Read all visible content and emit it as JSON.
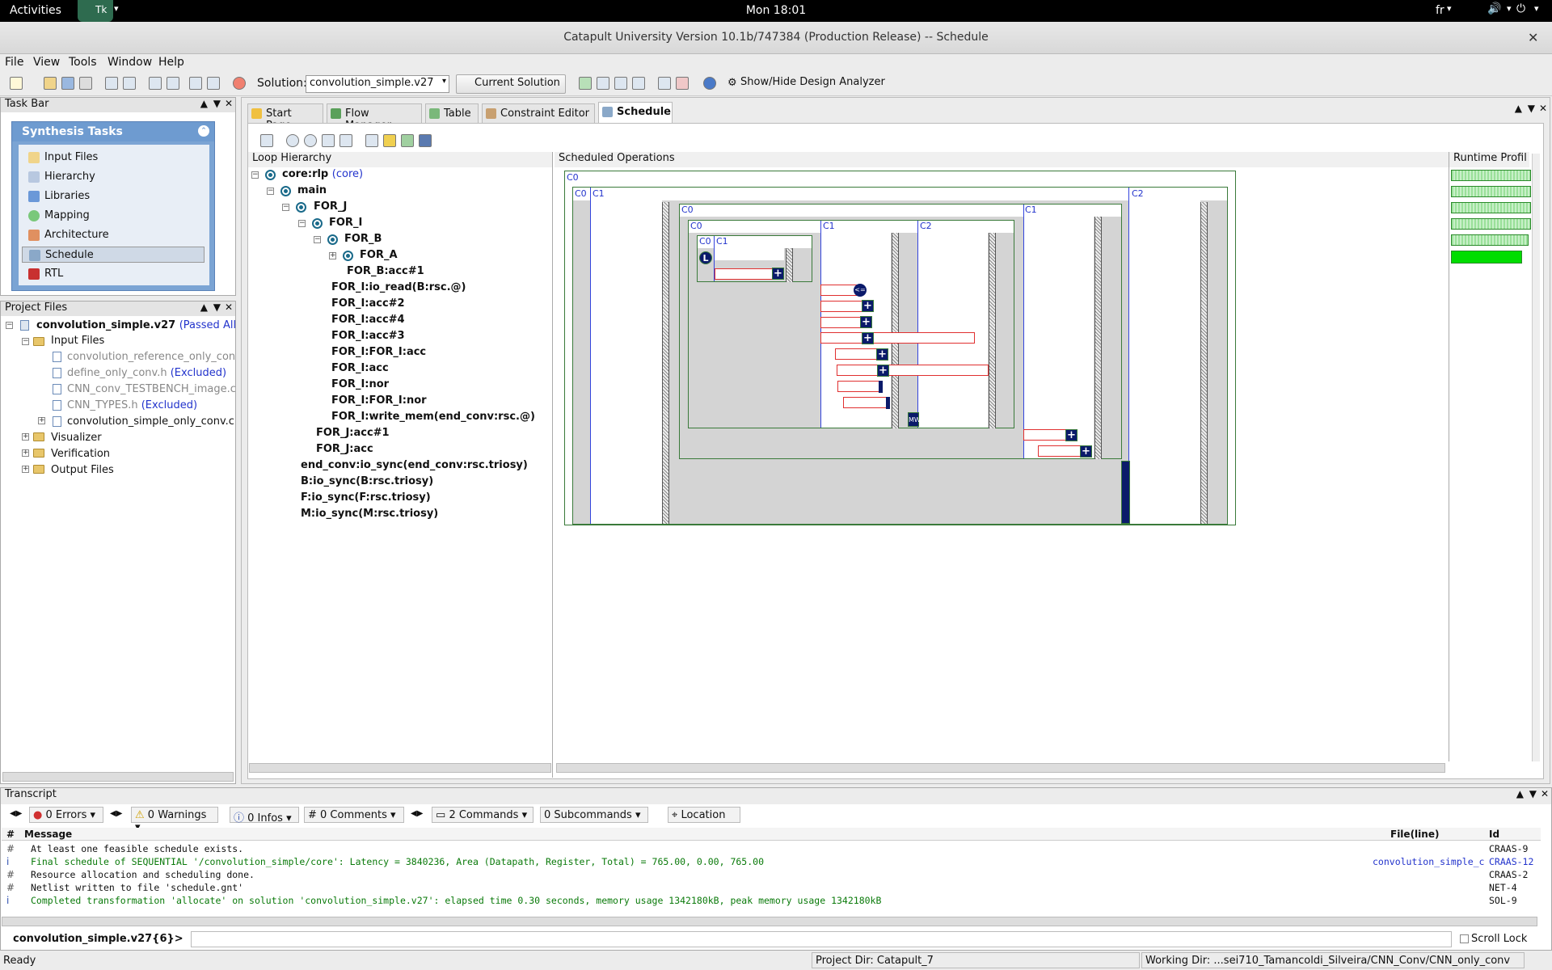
{
  "topbar": {
    "activities": "Activities",
    "clock": "Mon 18:01",
    "lang": "fr"
  },
  "window": {
    "title": "Catapult University Version 10.1b/747384 (Production Release) -- Schedule"
  },
  "menu": {
    "file": "File",
    "view": "View",
    "tools": "Tools",
    "window": "Window",
    "help": "Help"
  },
  "toolbar": {
    "solution_label": "Solution:",
    "solution_value": "convolution_simple.v27",
    "current_solution": "Current Solution",
    "design_analyzer": "Show/Hide Design Analyzer"
  },
  "taskbar": {
    "title": "Task Bar",
    "group": "Synthesis Tasks",
    "items": [
      "Input Files",
      "Hierarchy",
      "Libraries",
      "Mapping",
      "Architecture",
      "Schedule",
      "RTL"
    ],
    "selected": "Schedule"
  },
  "project": {
    "title": "Project Files",
    "root": "convolution_simple.v27",
    "root_status": "(Passed All",
    "input_files": "Input Files",
    "files": [
      {
        "name": "convolution_reference_only_con",
        "status": ""
      },
      {
        "name": "define_only_conv.h",
        "status": "(Excluded)"
      },
      {
        "name": "CNN_conv_TESTBENCH_image.c",
        "status": ""
      },
      {
        "name": "CNN_TYPES.h",
        "status": "(Excluded)"
      },
      {
        "name": "convolution_simple_only_conv.c",
        "status": ""
      }
    ],
    "folders": [
      "Visualizer",
      "Verification",
      "Output Files"
    ]
  },
  "tabs": [
    "Start Page",
    "Flow Manager",
    "Table",
    "Constraint Editor",
    "Schedule"
  ],
  "loop_hierarchy": {
    "title": "Loop Hierarchy",
    "core": "core:rlp",
    "core_tag": "(core)",
    "main": "main",
    "for_j": "FOR_J",
    "for_i": "FOR_I",
    "for_b": "FOR_B",
    "for_a": "FOR_A",
    "ops": [
      "FOR_B:acc#1",
      "FOR_I:io_read(B:rsc.@)",
      "FOR_I:acc#2",
      "FOR_I:acc#4",
      "FOR_I:acc#3",
      "FOR_I:FOR_I:acc",
      "FOR_I:acc",
      "FOR_I:nor",
      "FOR_I:FOR_I:nor",
      "FOR_I:write_mem(end_conv:rsc.@)"
    ],
    "j_ops": [
      "FOR_J:acc#1",
      "FOR_J:acc"
    ],
    "syncs": [
      "end_conv:io_sync(end_conv:rsc.triosy)",
      "B:io_sync(B:rsc.triosy)",
      "F:io_sync(F:rsc.triosy)",
      "M:io_sync(M:rsc.triosy)"
    ]
  },
  "schedule": {
    "title": "Scheduled Operations",
    "runtime": "Runtime Profil"
  },
  "transcript": {
    "title": "Transcript",
    "errors": "0 Errors",
    "warnings": "0 Warnings",
    "infos": "0 Infos",
    "comments": "0 Comments",
    "commands": "2 Commands",
    "subcommands": "0 Subcommands",
    "location": "Location",
    "col_message": "Message",
    "col_file": "File(line)",
    "col_id": "Id",
    "rows": [
      {
        "mark": "#",
        "text": "At least one feasible schedule exists.",
        "file": "",
        "id": "CRAAS-9",
        "green": false
      },
      {
        "mark": "i",
        "text": "Final schedule of SEQUENTIAL '/convolution_simple/core': Latency = 3840236, Area (Datapath, Register, Total) = 765.00, 0.00, 765.00",
        "file": "convolution_simple_c",
        "id": "CRAAS-12",
        "green": true
      },
      {
        "mark": "#",
        "text": "Resource allocation and scheduling done.",
        "file": "",
        "id": "CRAAS-2",
        "green": false
      },
      {
        "mark": "#",
        "text": "Netlist written to file 'schedule.gnt'",
        "file": "",
        "id": "NET-4",
        "green": false
      },
      {
        "mark": "i",
        "text": "Completed transformation 'allocate' on solution 'convolution_simple.v27': elapsed time 0.30 seconds, memory usage 1342180kB, peak memory usage 1342180kB",
        "file": "",
        "id": "SOL-9",
        "green": true
      }
    ],
    "prompt": "convolution_simple.v27{6}>",
    "scroll_lock": "Scroll Lock"
  },
  "status": {
    "ready": "Ready",
    "project_dir": "Project Dir: Catapult_7",
    "working_dir": "Working Dir: ...sei710_Tamancoldi_Silveira/CNN_Conv/CNN_only_conv"
  }
}
